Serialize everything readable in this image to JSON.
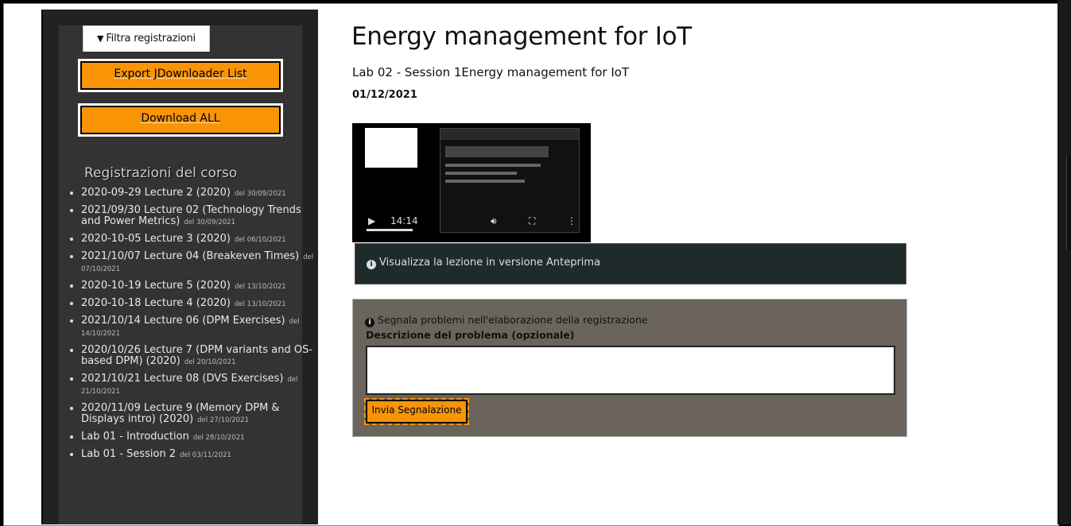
{
  "sidebar": {
    "filter_tab_label": "Filtra registrazioni",
    "export_button_label": "Export JDownloader List",
    "download_all_label": "Download ALL",
    "section_heading": "Registrazioni del corso",
    "recordings": [
      {
        "title": "2020-09-29 Lecture 2 (2020)",
        "date": "del 30/09/2021"
      },
      {
        "title": "2021/09/30 Lecture 02 (Technology Trends and Power Metrics)",
        "date": "del 30/09/2021"
      },
      {
        "title": "2020-10-05 Lecture 3 (2020)",
        "date": "del 06/10/2021"
      },
      {
        "title": "2021/10/07 Lecture 04 (Breakeven Times)",
        "date": "del 07/10/2021"
      },
      {
        "title": "2020-10-19 Lecture 5 (2020)",
        "date": "del 13/10/2021"
      },
      {
        "title": "2020-10-18 Lecture 4 (2020)",
        "date": "del 13/10/2021"
      },
      {
        "title": "2021/10/14 Lecture 06 (DPM Exercises)",
        "date": "del 14/10/2021"
      },
      {
        "title": "2020/10/26 Lecture 7 (DPM variants and OS-based DPM) (2020)",
        "date": "del 20/10/2021"
      },
      {
        "title": "2021/10/21 Lecture 08 (DVS Exercises)",
        "date": "del 21/10/2021"
      },
      {
        "title": "2020/11/09 Lecture 9 (Memory DPM & Displays intro) (2020)",
        "date": "del 27/10/2021"
      },
      {
        "title": "Lab 01 - Introduction",
        "date": "del 28/10/2021"
      },
      {
        "title": "Lab 01 - Session 2",
        "date": "del 03/11/2021"
      }
    ]
  },
  "main": {
    "title": "Energy management for IoT",
    "subtitle": "Lab 02 - Session 1Energy management for IoT",
    "date": "01/12/2021",
    "video": {
      "time": "14:14"
    },
    "preview_link": "Visualizza la lezione in versione Anteprima",
    "report": {
      "label": "Segnala problemi nell'elaborazione della registrazione",
      "description_label": "Descrizione del problema (opzionale)",
      "submit_label": "Invia Segnalazione"
    }
  }
}
